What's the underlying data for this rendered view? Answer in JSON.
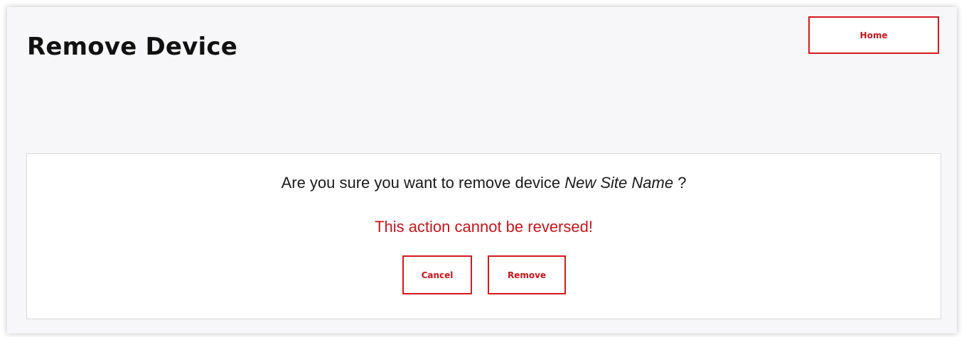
{
  "page": {
    "title": "Remove Device"
  },
  "header": {
    "home_label": "Home"
  },
  "confirm": {
    "question_prefix": "Are you sure you want to remove device",
    "device_name": "New Site Name",
    "question_suffix": "?",
    "warning": "This action cannot be reversed!",
    "cancel_label": "Cancel",
    "remove_label": "Remove"
  },
  "colors": {
    "accent": "#d6191e",
    "page_background": "#f7f7f9",
    "panel_background": "#ffffff",
    "text": "#1a1a1a"
  }
}
